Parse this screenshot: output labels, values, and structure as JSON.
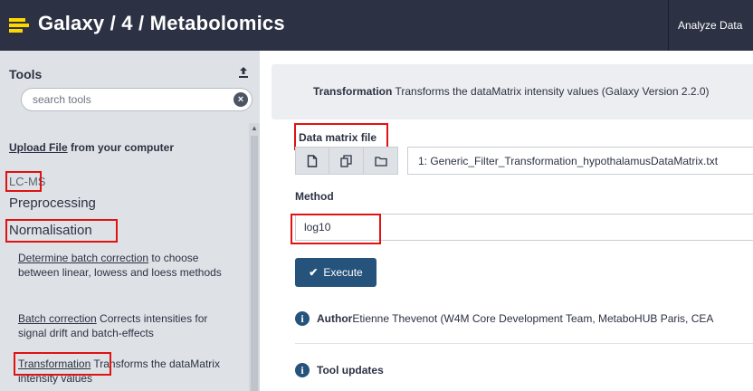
{
  "masthead": {
    "title": "Galaxy / 4 / Metabolomics",
    "logo_icon": "galaxy-bars-icon",
    "nav_analyze": "Analyze Data",
    "brand_color": "#2c3143",
    "logo_color": "#ffd700"
  },
  "tool_panel": {
    "header": "Tools",
    "upload_icon": "upload-icon",
    "search": {
      "placeholder": "search tools",
      "value": ""
    },
    "clear_icon": "clear-icon",
    "upload": {
      "link": "Upload File",
      "rest": " from your computer"
    },
    "sections": {
      "lcms": "LC-MS",
      "preprocessing": "Preprocessing",
      "normalisation": "Normalisation"
    },
    "tools": [
      {
        "name": "Determine batch correction",
        "description": " to choose between linear, lowess and loess methods"
      },
      {
        "name": "Batch correction",
        "description": " Corrects intensities for signal drift and batch-effects"
      },
      {
        "name": "Transformation",
        "description": " Transforms the dataMatrix intensity values"
      }
    ]
  },
  "tool_form": {
    "name": "Transformation",
    "description": " Transforms the dataMatrix intensity values (Galaxy Version 2.2.0)",
    "data_matrix_label": "Data matrix file",
    "data_matrix_value": "1: Generic_Filter_Transformation_hypothalamusDataMatrix.txt",
    "input_icons": [
      "file-icon",
      "files-icon",
      "folder-icon"
    ],
    "method_label": "Method",
    "method_value": "log10",
    "execute_label": "Execute",
    "accent_color": "#25537b",
    "highlight_color": "#e01212",
    "author_label": "Author",
    "author_text": " Etienne Thevenot (W4M Core Development Team, MetaboHUB Paris, CEA",
    "updates_label": "Tool updates"
  }
}
